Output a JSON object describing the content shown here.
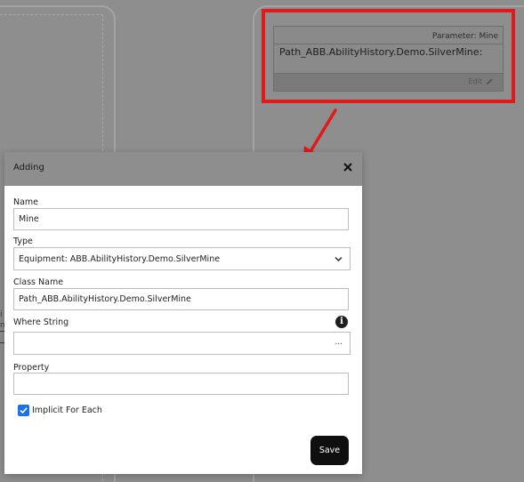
{
  "background": {
    "card": {
      "parameter_label": "Parameter: Mine",
      "path_text": "Path_ABB.AbilityHistory.Demo.SilverMine:",
      "edit_label": "Edit"
    },
    "side_text": "i\nn"
  },
  "modal": {
    "title": "Adding",
    "name_label": "Name",
    "name_value": "Mine",
    "type_label": "Type",
    "type_value": "Equipment: ABB.AbilityHistory.Demo.SilverMine",
    "class_name_label": "Class Name",
    "class_name_value": "Path_ABB.AbilityHistory.Demo.SilverMine",
    "where_string_label": "Where String",
    "where_string_value": "",
    "ellipsis_label": "...",
    "property_label": "Property",
    "property_value": "",
    "implicit_label": "Implicit For Each",
    "implicit_checked": true,
    "save_label": "Save"
  },
  "colors": {
    "highlight": "#e0191b",
    "checkbox": "#1a73e8",
    "save_button": "#0f0f0f",
    "overlay": "#8e8e8e"
  },
  "icons": [
    "close-icon",
    "chevron-down-icon",
    "info-icon",
    "ellipsis-icon",
    "edit-icon",
    "check-icon",
    "arrow-annotation"
  ]
}
